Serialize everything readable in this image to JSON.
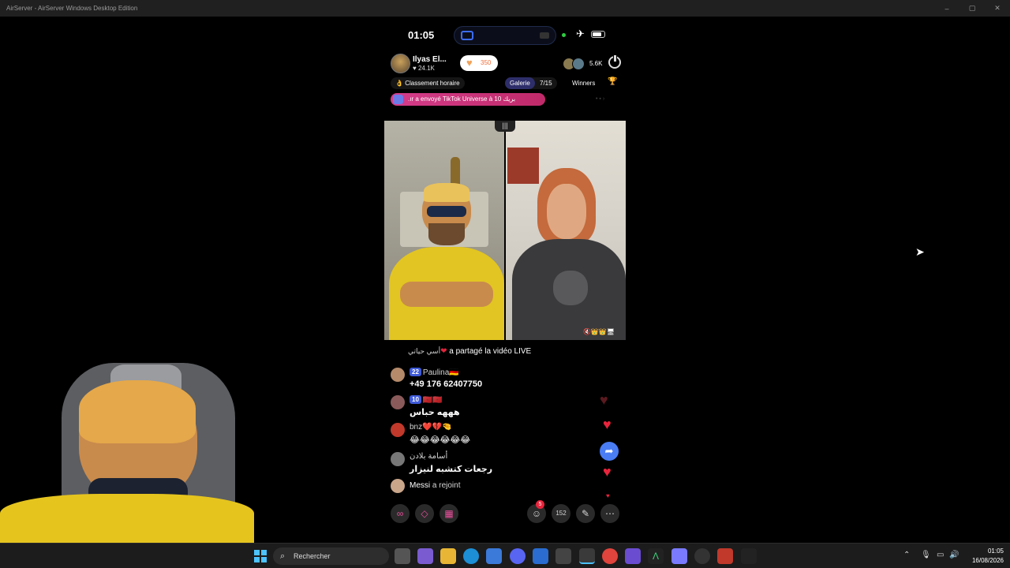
{
  "window": {
    "title": "AirServer - AirServer Windows Desktop Edition",
    "controls": [
      "–",
      "▢",
      "✕"
    ]
  },
  "phone_status": {
    "time": "01:05",
    "airplane": "✈"
  },
  "live": {
    "host_name": "Ilyas El...",
    "host_likes": "24.1K",
    "host_likes_icon": "♥",
    "follow_count": "350",
    "viewer_count": "5.6K",
    "ranking_label": "Classement horaire",
    "ranking_icon": "👌",
    "galerie_label": "Galerie",
    "galerie_count": "7/15",
    "winners_label": "Winners",
    "gift_banner": "a envoyé TikTok Universe à 10 ‫بريك‬",
    "gift_banner_prefix": ".ır",
    "divider_icon": "|||",
    "video_overlay_icons": "🔇👑👑🖥"
  },
  "shared_line": {
    "user": "أسي حياتي",
    "text": "a partagé la vidéo LIVE"
  },
  "comments": [
    {
      "badge": "22",
      "name": "Paulina🇩🇪",
      "text": "+49 176 62407750",
      "avatar_color": "#b48a6a"
    },
    {
      "badge": "10",
      "name": "🇲🇦🇲🇦",
      "text": "هههه حباس",
      "avatar_color": "#8a5a5a"
    },
    {
      "badge": "",
      "name": "bnz❤️💔🤏",
      "text": "😂😂😂😂😂😂",
      "avatar_color": "#c0392b"
    },
    {
      "badge": "",
      "name": "أسامة بلادن",
      "text": "رجعات كتشبه لنيزار",
      "avatar_color": "#777777"
    }
  ],
  "joined": {
    "name": "Messi",
    "text": "a rejoint"
  },
  "toolbar": {
    "notif_badge": "5",
    "share_count": "152",
    "icons": [
      "link-icon",
      "match-icon",
      "grid-icon",
      "question-icon",
      "share-icon",
      "magic-wand-icon",
      "more-icon"
    ]
  },
  "taskbar": {
    "search_placeholder": "Rechercher",
    "time": "01:05",
    "date": "16/08/2026"
  },
  "colors": {
    "titlebar_bg": "#202020",
    "taskbar_bg": "#1c1c1c",
    "gift_pink": "#d43c8a",
    "heart_red": "#e8243c",
    "share_blue": "#4a7cf3",
    "badge_blue": "#3f5bd8"
  }
}
